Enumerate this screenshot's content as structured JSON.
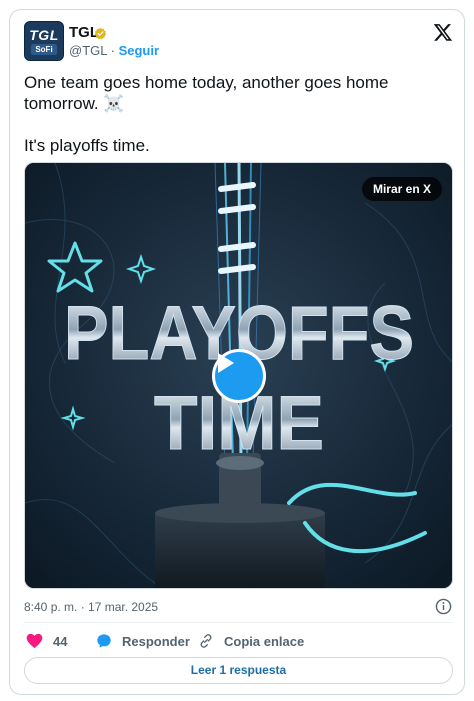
{
  "author": {
    "avatar_top": "TGL",
    "avatar_bottom": "SoFi",
    "name": "TGL",
    "handle": "@TGL",
    "separator": "·",
    "follow_label": "Seguir"
  },
  "tweet": {
    "line1": "One team goes home today, another goes home tomorrow. ☠️",
    "line2": "It's playoffs time."
  },
  "media": {
    "watch_label": "Mirar en X",
    "headline_1": "PLAYOFFS",
    "headline_2": "TIME"
  },
  "meta": {
    "timestamp": "8:40 p. m. · 17 mar. 2025"
  },
  "actions": {
    "like_count": "44",
    "reply_label": "Responder",
    "copy_label": "Copia enlace"
  },
  "read_reply_label": "Leer 1 respuesta",
  "colors": {
    "accent": "#1d9bf0",
    "like": "#f91880",
    "verified": "#e2b719"
  }
}
